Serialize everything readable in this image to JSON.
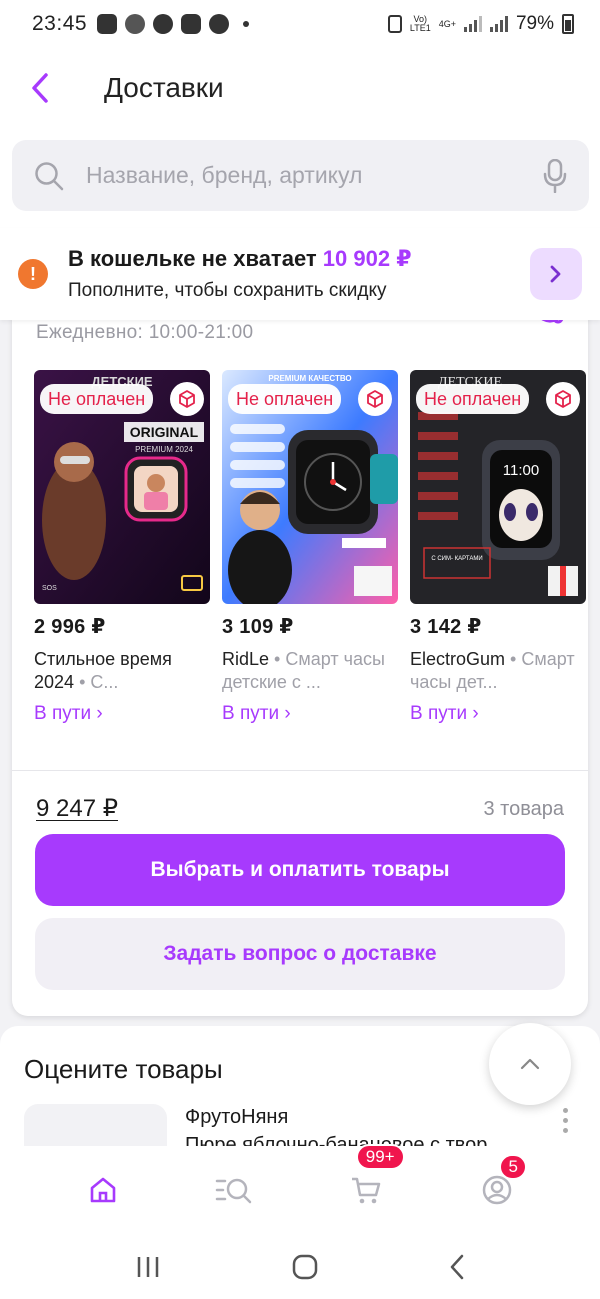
{
  "status_bar": {
    "time": "23:45",
    "volte_top": "Vo)",
    "volte_bottom": "LTE1",
    "network": "4G+",
    "battery": "79%"
  },
  "header": {
    "title": "Доставки"
  },
  "search": {
    "placeholder": "Название, бренд, артикул"
  },
  "wallet": {
    "title_prefix": "В кошельке не хватает",
    "amount": "10 902 ₽",
    "subtitle": "Пополните, чтобы сохранить скидку"
  },
  "order": {
    "hours": "Ежедневно: 10:00-21:00",
    "products": [
      {
        "price": "2 996 ₽",
        "brand": "Стильное время 2024",
        "category": "С...",
        "status": "В пути ›",
        "badge": "Не оплачен",
        "image_text": {
          "top": "ДЕТСКИЕ",
          "mid": "ORIGINAL",
          "sub": "PREMIUM 2024"
        }
      },
      {
        "price": "3 109 ₽",
        "brand": "RidLe",
        "category": "Смарт часы детские с ...",
        "status": "В пути ›",
        "badge": "Не оплачен",
        "image_text": {
          "top": "PREMIUM КАЧЕСТВО",
          "mid": "",
          "sub": ""
        }
      },
      {
        "price": "3 142 ₽",
        "brand": "ElectroGum",
        "category": "Смарт часы дет...",
        "status": "В пути ›",
        "badge": "Не оплачен",
        "image_text": {
          "top": "ДЕТСКИЕ",
          "mid": "11:00",
          "sub": "С СИМ- КАРТАМИ"
        }
      }
    ],
    "total": "9 247 ₽",
    "count": "3 товара",
    "pay_button": "Выбрать и оплатить товары",
    "ask_button": "Задать вопрос о доставке"
  },
  "rate": {
    "title": "Оцените товары",
    "item_brand": "ФрутоНяня",
    "item_name": "Пюре яблочно-банановое с твор"
  },
  "tabbar": {
    "cart_badge": "99+",
    "profile_badge": "5"
  },
  "colors": {
    "accent": "#a73afd",
    "warning": "#f0772f",
    "unpaid": "#e4224b",
    "badge": "#f0154d"
  }
}
